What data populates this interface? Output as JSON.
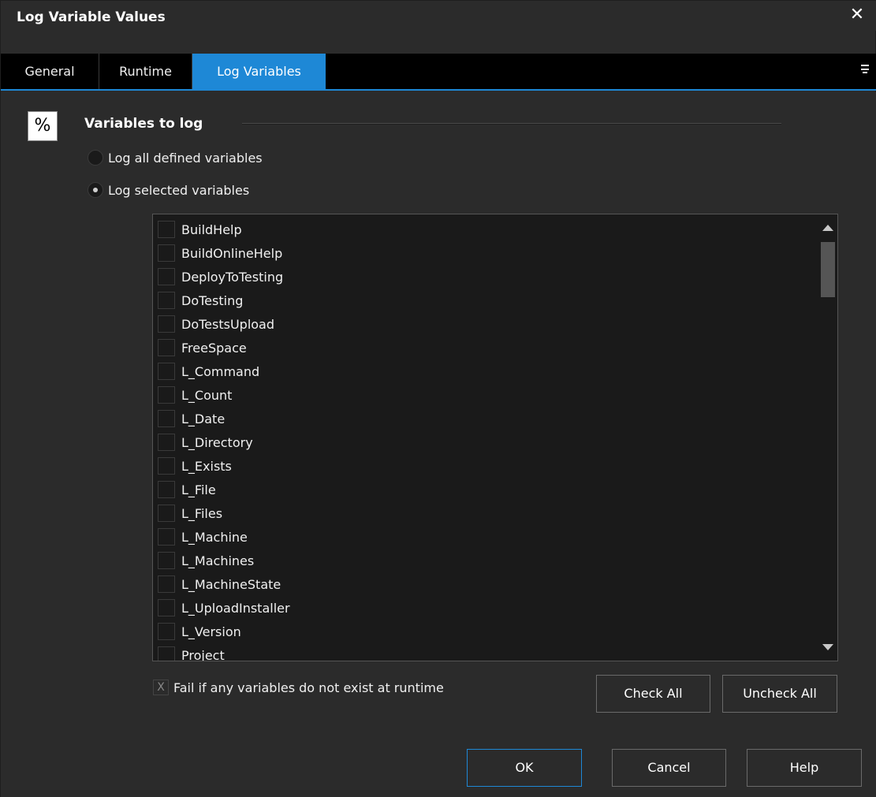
{
  "window": {
    "title": "Log Variable Values",
    "close_symbol": "✕"
  },
  "tabs": [
    {
      "label": "General",
      "active": false
    },
    {
      "label": "Runtime",
      "active": false
    },
    {
      "label": "Log Variables",
      "active": true
    }
  ],
  "icon": {
    "symbol": "%",
    "name": "percent-icon"
  },
  "group": {
    "label": "Variables to log"
  },
  "radios": {
    "all_label": "Log all defined variables",
    "selected_label": "Log selected variables",
    "selected_value": "selected"
  },
  "variables": [
    {
      "label": "BuildHelp",
      "checked": false
    },
    {
      "label": "BuildOnlineHelp",
      "checked": false
    },
    {
      "label": "DeployToTesting",
      "checked": false
    },
    {
      "label": "DoTesting",
      "checked": false
    },
    {
      "label": "DoTestsUpload",
      "checked": false
    },
    {
      "label": "FreeSpace",
      "checked": false
    },
    {
      "label": "L_Command",
      "checked": false
    },
    {
      "label": "L_Count",
      "checked": false
    },
    {
      "label": "L_Date",
      "checked": false
    },
    {
      "label": "L_Directory",
      "checked": false
    },
    {
      "label": "L_Exists",
      "checked": false
    },
    {
      "label": "L_File",
      "checked": false
    },
    {
      "label": "L_Files",
      "checked": false
    },
    {
      "label": "L_Machine",
      "checked": false
    },
    {
      "label": "L_Machines",
      "checked": false
    },
    {
      "label": "L_MachineState",
      "checked": false
    },
    {
      "label": "L_UploadInstaller",
      "checked": false
    },
    {
      "label": "L_Version",
      "checked": false
    },
    {
      "label": "Project",
      "checked": false
    }
  ],
  "fail_option": {
    "label": "Fail if any variables do not exist at runtime",
    "checked": true,
    "disabled": true,
    "mark": "X"
  },
  "buttons": {
    "check_all": "Check All",
    "uncheck_all": "Uncheck All",
    "ok": "OK",
    "cancel": "Cancel",
    "help": "Help"
  },
  "colors": {
    "accent": "#1e88d6",
    "background": "#2b2b2b",
    "tabbar": "#000000",
    "list_bg": "#1a1a1a"
  }
}
